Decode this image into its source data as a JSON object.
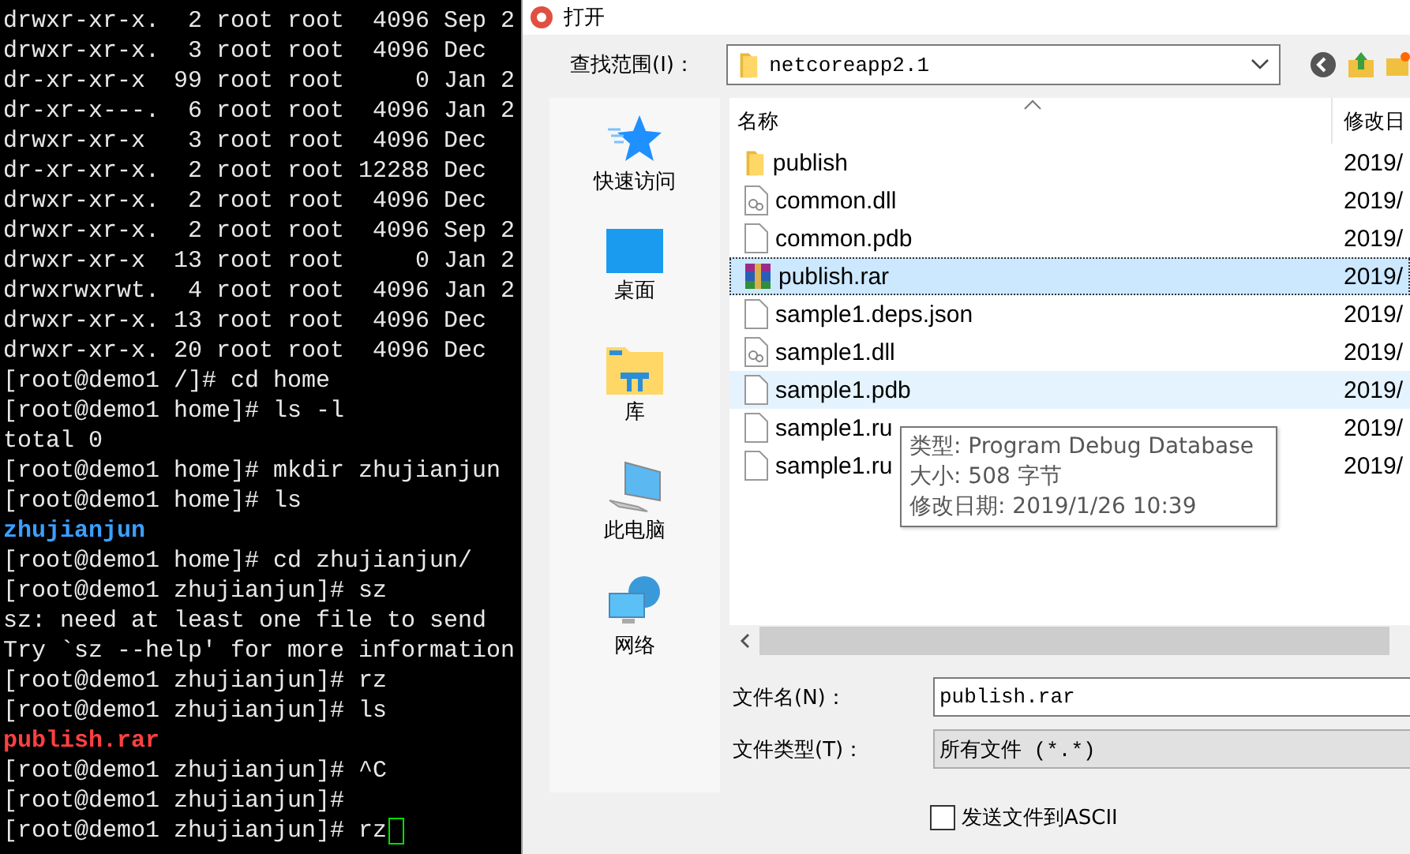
{
  "terminal": {
    "lines": [
      {
        "kind": "output",
        "text": "drwxr-xr-x.  2 root root  4096 Sep 2"
      },
      {
        "kind": "output",
        "text": "drwxr-xr-x.  3 root root  4096 Dec"
      },
      {
        "kind": "output",
        "text": "dr-xr-xr-x  99 root root     0 Jan 2"
      },
      {
        "kind": "output",
        "text": "dr-xr-x---.  6 root root  4096 Jan 2"
      },
      {
        "kind": "output",
        "text": "drwxr-xr-x   3 root root  4096 Dec"
      },
      {
        "kind": "output",
        "text": "dr-xr-xr-x.  2 root root 12288 Dec"
      },
      {
        "kind": "output",
        "text": "drwxr-xr-x.  2 root root  4096 Dec"
      },
      {
        "kind": "output",
        "text": "drwxr-xr-x.  2 root root  4096 Sep 2"
      },
      {
        "kind": "output",
        "text": "drwxr-xr-x  13 root root     0 Jan 2"
      },
      {
        "kind": "output",
        "text": "drwxrwxrwt.  4 root root  4096 Jan 2"
      },
      {
        "kind": "output",
        "text": "drwxr-xr-x. 13 root root  4096 Dec"
      },
      {
        "kind": "output",
        "text": "drwxr-xr-x. 20 root root  4096 Dec"
      },
      {
        "kind": "output",
        "text": "[root@demo1 /]# cd home"
      },
      {
        "kind": "output",
        "text": "[root@demo1 home]# ls -l"
      },
      {
        "kind": "output",
        "text": "total 0"
      },
      {
        "kind": "output",
        "text": "[root@demo1 home]# mkdir zhujianjun"
      },
      {
        "kind": "output",
        "text": "[root@demo1 home]# ls"
      },
      {
        "kind": "directory",
        "text": "zhujianjun"
      },
      {
        "kind": "output",
        "text": "[root@demo1 home]# cd zhujianjun/"
      },
      {
        "kind": "output",
        "text": "[root@demo1 zhujianjun]# sz"
      },
      {
        "kind": "output",
        "text": "sz: need at least one file to send"
      },
      {
        "kind": "output",
        "text": "Try `sz --help' for more information"
      },
      {
        "kind": "output",
        "text": "[root@demo1 zhujianjun]# rz"
      },
      {
        "kind": "output",
        "text": "[root@demo1 zhujianjun]# ls"
      },
      {
        "kind": "archive",
        "text": "publish.rar"
      },
      {
        "kind": "output",
        "text": "[root@demo1 zhujianjun]# ^C"
      },
      {
        "kind": "output",
        "text": "[root@demo1 zhujianjun]#"
      },
      {
        "kind": "output",
        "text": "[root@demo1 zhujianjun]# rz"
      }
    ],
    "cursor": true
  },
  "dialog": {
    "title": "打开",
    "look_in": {
      "label": "查找范围(I)：",
      "value": "netcoreapp2.1"
    },
    "places": [
      {
        "kind": "quick",
        "label": "快速访问"
      },
      {
        "kind": "desktop",
        "label": "桌面"
      },
      {
        "kind": "library",
        "label": "库"
      },
      {
        "kind": "computer",
        "label": "此电脑"
      },
      {
        "kind": "network",
        "label": "网络"
      }
    ],
    "columns": [
      "名称",
      "修改日"
    ],
    "files": [
      {
        "kind": "folder",
        "name": "publish",
        "date": "2019/",
        "selected": false,
        "hovered": false
      },
      {
        "kind": "dll",
        "name": "common.dll",
        "date": "2019/",
        "selected": false,
        "hovered": false
      },
      {
        "kind": "file",
        "name": "common.pdb",
        "date": "2019/",
        "selected": false,
        "hovered": false
      },
      {
        "kind": "archive",
        "name": "publish.rar",
        "date": "2019/",
        "selected": true,
        "hovered": false
      },
      {
        "kind": "file",
        "name": "sample1.deps.json",
        "date": "2019/",
        "selected": false,
        "hovered": false
      },
      {
        "kind": "dll",
        "name": "sample1.dll",
        "date": "2019/",
        "selected": false,
        "hovered": false
      },
      {
        "kind": "file",
        "name": "sample1.pdb",
        "date": "2019/",
        "selected": false,
        "hovered": true
      },
      {
        "kind": "file",
        "name": "sample1.ru",
        "date": "2019/",
        "selected": false,
        "hovered": false
      },
      {
        "kind": "file",
        "name": "sample1.ru",
        "date": "2019/",
        "selected": false,
        "hovered": false
      }
    ],
    "tooltip": {
      "lines": [
        "类型: Program Debug Database",
        "大小: 508 字节",
        "修改日期: 2019/1/26 10:39"
      ]
    },
    "file_name": {
      "label": "文件名(N)：",
      "value": "publish.rar"
    },
    "file_type": {
      "label": "文件类型(T)：",
      "value": "所有文件 (*.*)"
    },
    "ascii": {
      "label": "发送文件到ASCII",
      "checked": false
    }
  }
}
